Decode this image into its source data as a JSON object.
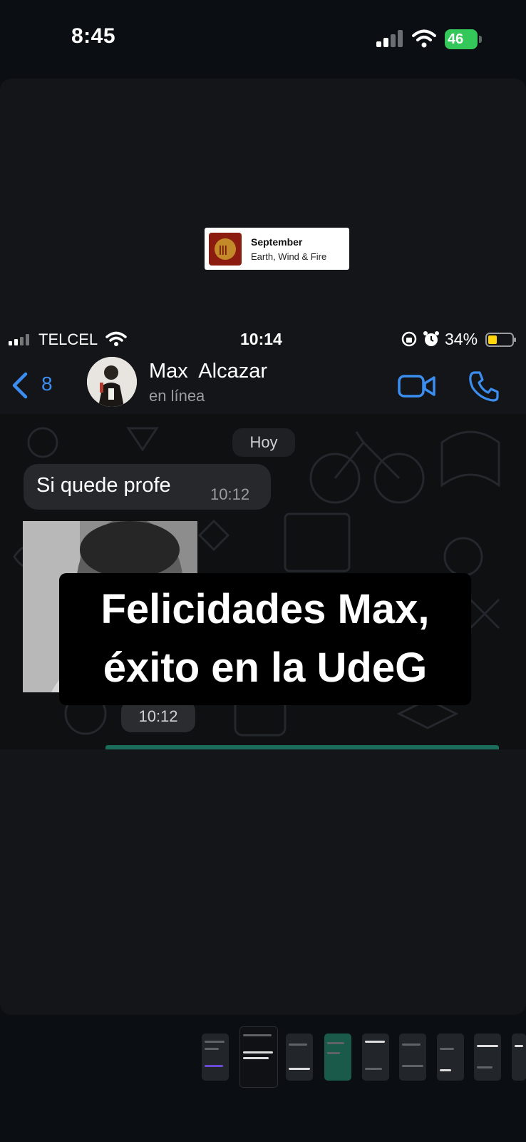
{
  "outer_status": {
    "time": "8:45",
    "battery": "46"
  },
  "now_playing": {
    "title": "September",
    "artist": "Earth, Wind & Fire"
  },
  "inner_status": {
    "carrier": "TELCEL",
    "time": "10:14",
    "battery": "34%"
  },
  "chat_header": {
    "back_count": "8",
    "contact_name": "Max  Alcazar",
    "contact_status": "en línea"
  },
  "chat": {
    "day_label": "Hoy",
    "messages": [
      {
        "text": "Si quede profe",
        "time": "10:12"
      }
    ],
    "photo_time": "10:12"
  },
  "caption": {
    "line1": "Felicidades Max,",
    "line2": "éxito en la UdeG"
  },
  "colors": {
    "accent": "#3b8ef0",
    "battery_green": "#34c759",
    "bubble": "#26282b",
    "caption_bg": "#000000"
  },
  "icons": [
    "signal-icon",
    "wifi-icon",
    "battery-icon",
    "back-chevron-icon",
    "video-call-icon",
    "phone-icon",
    "lock-rotation-icon",
    "alarm-icon"
  ]
}
